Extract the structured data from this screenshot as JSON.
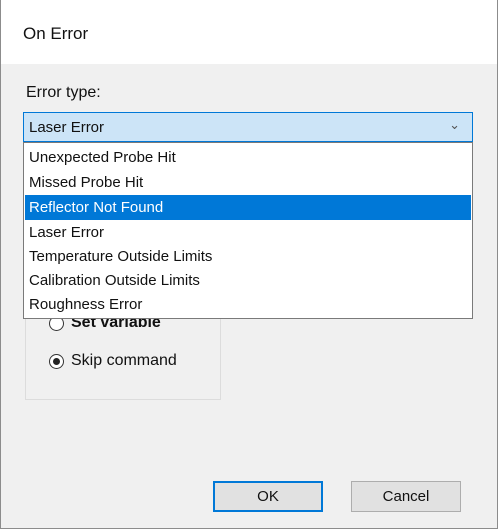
{
  "window": {
    "title": "On Error"
  },
  "error_type": {
    "label": "Error type:",
    "selected_value": "Laser Error",
    "options": [
      "Unexpected Probe Hit",
      "Missed Probe Hit",
      "Reflector Not Found",
      "Laser Error",
      "Temperature Outside Limits",
      "Calibration Outside Limits",
      "Roughness Error"
    ],
    "highlighted_index": 2
  },
  "action": {
    "options": [
      {
        "label": "Set variable",
        "checked": false
      },
      {
        "label": "Skip command",
        "checked": true
      }
    ]
  },
  "buttons": {
    "ok": "OK",
    "cancel": "Cancel"
  },
  "colors": {
    "accent": "#0078d7",
    "combo_bg": "#cce4f7",
    "dialog_bg": "#f0f0f0"
  }
}
